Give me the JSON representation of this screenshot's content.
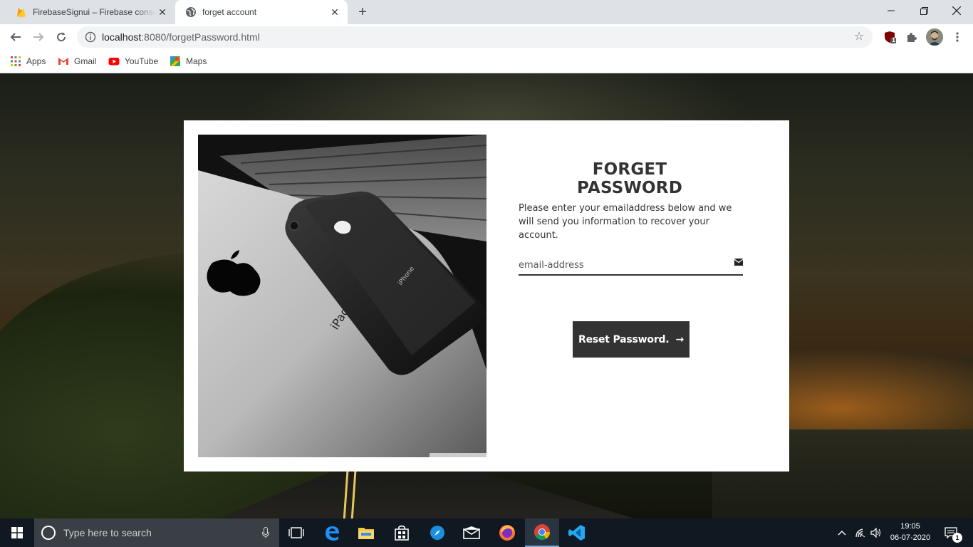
{
  "browser": {
    "tabs": [
      {
        "title": "FirebaseSignui – Firebase console",
        "active": false
      },
      {
        "title": "forget account",
        "active": true
      }
    ],
    "url_host": "localhost",
    "url_rest": ":8080/forgetPassword.html",
    "bookmarks": [
      "Apps",
      "Gmail",
      "YouTube",
      "Maps"
    ],
    "extension_badge": "1"
  },
  "form": {
    "title": "FORGET PASSWORD",
    "description": "Please enter your emailaddress below and we will send you information to recover your account.",
    "email_placeholder": "email-address",
    "button_label": "Reset Password.",
    "button_arrow": "→"
  },
  "taskbar": {
    "search_placeholder": "Type here to search",
    "time": "19:05",
    "date": "06-07-2020",
    "notification_count": "1",
    "apps": [
      "task-view",
      "edge",
      "file-explorer",
      "store",
      "safari-like",
      "mail",
      "firefox",
      "chrome",
      "vscode"
    ]
  },
  "colors": {
    "button_bg": "#333333",
    "taskbar_bg": "#101821",
    "tab_strip": "#dee1e6"
  }
}
